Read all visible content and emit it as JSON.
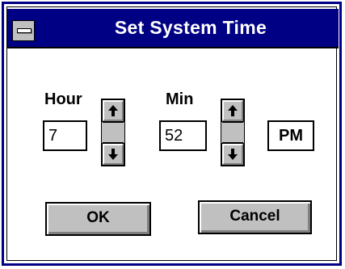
{
  "window": {
    "title": "Set System Time"
  },
  "hour": {
    "label": "Hour",
    "value": "7"
  },
  "minute": {
    "label": "Min",
    "value": "52"
  },
  "ampm": {
    "value": "PM"
  },
  "buttons": {
    "ok_label": "OK",
    "cancel_label": "Cancel"
  },
  "icons": {
    "system_menu": "system-menu-icon",
    "spin_up": "arrow-up-icon",
    "spin_down": "arrow-down-icon"
  },
  "colors": {
    "title_bar": "#000084",
    "button_face": "#c0c0c0",
    "background": "#ffffff"
  }
}
